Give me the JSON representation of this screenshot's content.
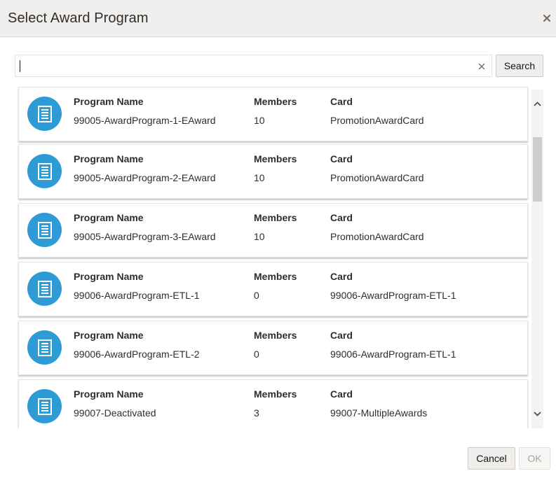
{
  "dialog": {
    "title": "Select Award Program",
    "close_icon": "close-icon"
  },
  "search": {
    "value": "",
    "placeholder": "",
    "clear_icon": "clear-icon",
    "button_label": "Search"
  },
  "labels": {
    "program_name": "Program Name",
    "members": "Members",
    "card": "Card"
  },
  "programs": [
    {
      "name": "99005-AwardProgram-1-EAward",
      "members": "10",
      "card": "PromotionAwardCard"
    },
    {
      "name": "99005-AwardProgram-2-EAward",
      "members": "10",
      "card": "PromotionAwardCard"
    },
    {
      "name": "99005-AwardProgram-3-EAward",
      "members": "10",
      "card": "PromotionAwardCard"
    },
    {
      "name": "99006-AwardProgram-ETL-1",
      "members": "0",
      "card": "99006-AwardProgram-ETL-1"
    },
    {
      "name": "99006-AwardProgram-ETL-2",
      "members": "0",
      "card": "99006-AwardProgram-ETL-1"
    },
    {
      "name": "99007-Deactivated",
      "members": "3",
      "card": "99007-MultipleAwards"
    }
  ],
  "footer": {
    "cancel_label": "Cancel",
    "ok_label": "OK"
  },
  "colors": {
    "icon_circle": "#2f9bd6",
    "header_bg": "#f1efed"
  }
}
